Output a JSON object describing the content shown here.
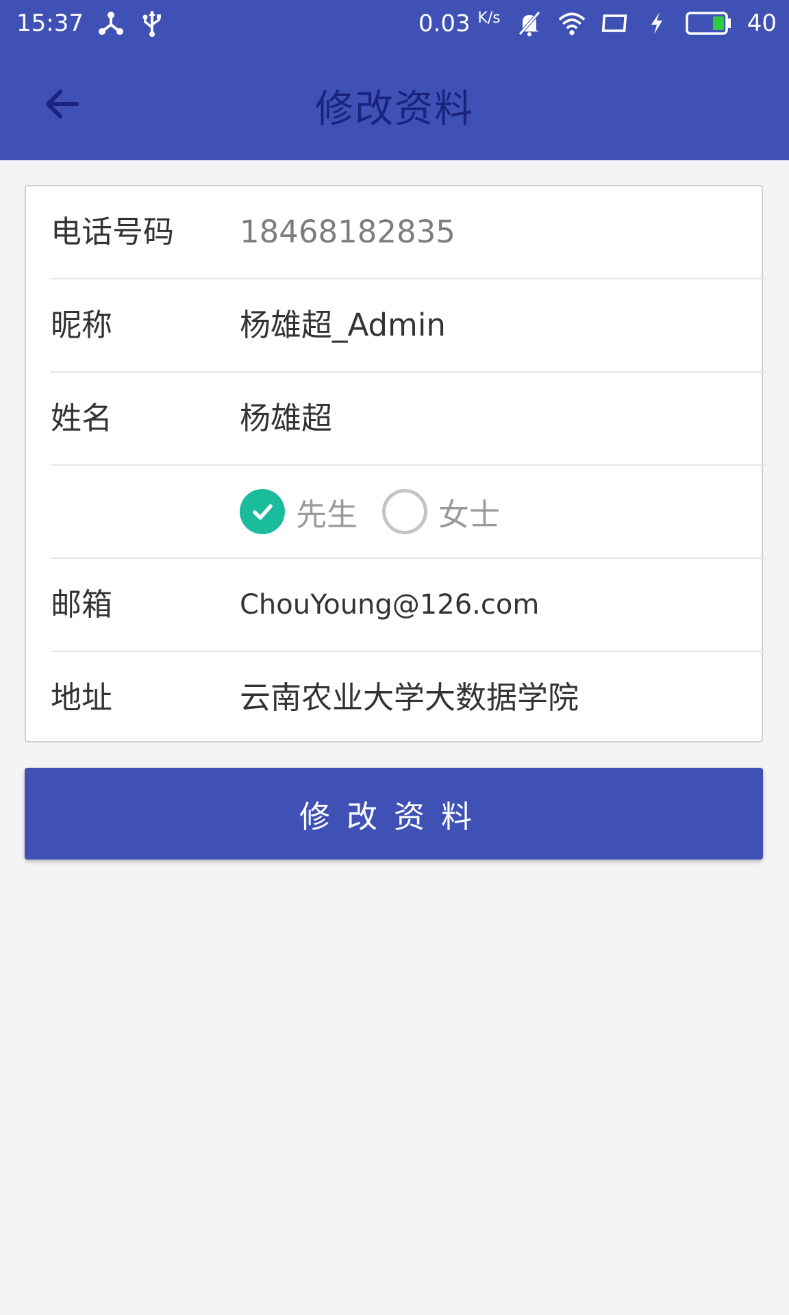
{
  "status_bar": {
    "time": "15:37",
    "net_speed": "0.03",
    "net_speed_unit": "K/s",
    "battery_level": "40",
    "icons": [
      "share-icon",
      "usb-icon",
      "mute-icon",
      "wifi-icon",
      "screen-icon",
      "charging-icon",
      "battery-icon"
    ]
  },
  "app_bar": {
    "title": "修改资料",
    "back_icon": "arrow-left-icon"
  },
  "form": {
    "phone": {
      "label": "电话号码",
      "value": "18468182835"
    },
    "nickname": {
      "label": "昵称",
      "value": "杨雄超_Admin"
    },
    "name": {
      "label": "姓名",
      "value": "杨雄超"
    },
    "gender": {
      "options": [
        {
          "label": "先生",
          "checked": true
        },
        {
          "label": "女士",
          "checked": false
        }
      ]
    },
    "email": {
      "label": "邮箱",
      "value": "ChouYoung@126.com"
    },
    "address": {
      "label": "地址",
      "value": "云南农业大学大数据学院"
    }
  },
  "submit_button": {
    "label": "修改资料"
  },
  "colors": {
    "primary": "#3f51b5",
    "title": "#1a237e",
    "accent": "#1abc9c",
    "background": "#f4f4f4"
  }
}
